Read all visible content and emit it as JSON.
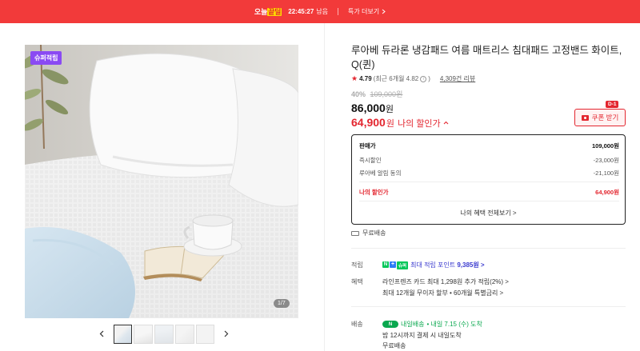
{
  "banner": {
    "brand_pre": "오늘",
    "brand_hl": "끝딜",
    "timer": "22:45:27",
    "remain": "남음",
    "more": "특가 더보기",
    "color": "#f23a3a"
  },
  "gallery": {
    "badge": "슈퍼적립",
    "counter": "1/7",
    "prev_icon": "chevron-left-icon",
    "next_icon": "chevron-right-icon",
    "thumb_count": 5
  },
  "product": {
    "title": "루아베 듀라론 냉감패드 여름 매트리스 침대패드 고정밴드 화이트, Q(퀸)",
    "rating": "4.79",
    "rating_recent": "(최근 6개월 4.82",
    "rating_info": "i",
    "rating_close": ")",
    "reviews": "4,309건 리뷰",
    "discount_pct": "40%",
    "original_price": "109,000원",
    "sale_price": "86,000",
    "sale_unit": "원",
    "my_price": "64,900",
    "my_unit": "원",
    "my_label": "나의 할인가",
    "my_caret": "^",
    "accent": "#e3262f"
  },
  "coupon": {
    "label": "쿠폰 받기",
    "dday": "D-1"
  },
  "breakdown": {
    "rows": [
      {
        "label": "판매가",
        "value": "109,000원"
      },
      {
        "label": "즉시할인",
        "value": "-23,000원"
      },
      {
        "label": "루아베 알림 동의",
        "value": "-21,100원"
      },
      {
        "label": "나의 할인가",
        "value": "64,900원"
      }
    ],
    "all_benefits": "나의 혜택 전체보기 >"
  },
  "shipping_free": "무료배송",
  "info": {
    "points_label": "적립",
    "points_n": "N",
    "points_p": "+",
    "points_s": "슈퍼",
    "points_text": "최대 적립 포인트",
    "points_value": "9,385원 >",
    "benefit_label": "혜택",
    "benefit_1": "라인프렌즈 카드 최대 1,298원 추가 적립(2%) >",
    "benefit_2": "최대 12개월 무이자 할부 • 60개월 특별금리 >",
    "delivery_label": "배송",
    "delivery_badge": "N",
    "delivery_title": "내일배송",
    "delivery_date": "• 내일 7.15 (수) 도착",
    "delivery_line2": "밤 12시까지 결제 시 내일도착",
    "delivery_line3": "무료배송"
  }
}
